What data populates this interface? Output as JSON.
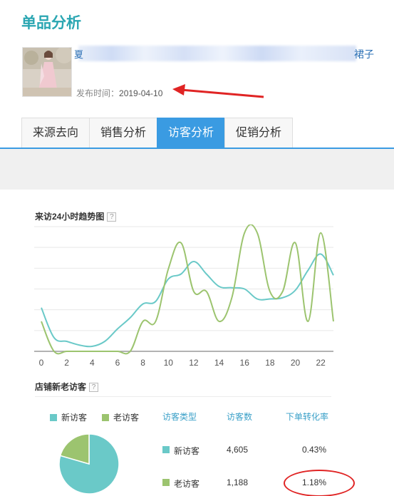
{
  "page_title": "单品分析",
  "product": {
    "name_start": "夏",
    "name_end": "裙子",
    "publish_label": "发布时间：",
    "publish_date": "2019-04-10"
  },
  "tabs": [
    {
      "label": "来源去向",
      "active": false
    },
    {
      "label": "销售分析",
      "active": false
    },
    {
      "label": "访客分析",
      "active": true
    },
    {
      "label": "促销分析",
      "active": false
    }
  ],
  "colors": {
    "accent": "#3a9be2",
    "title": "#2aa6b2",
    "new_visitor": "#6ac9c8",
    "old_visitor": "#9cc46f",
    "highlight_circle": "#e02424",
    "arrow": "#e02424"
  },
  "trend": {
    "title": "来访24小时趋势图",
    "help": "?"
  },
  "chart_data": [
    {
      "type": "line",
      "title": "来访24小时趋势图",
      "x": [
        0,
        1,
        2,
        3,
        4,
        5,
        6,
        7,
        8,
        9,
        10,
        11,
        12,
        13,
        14,
        15,
        16,
        17,
        18,
        19,
        20,
        21,
        22,
        23
      ],
      "xticks": [
        "0",
        "2",
        "4",
        "6",
        "8",
        "10",
        "12",
        "14",
        "16",
        "18",
        "20",
        "22"
      ],
      "xlim": [
        0,
        23
      ],
      "ylim": [
        0,
        100
      ],
      "grid": true,
      "series": [
        {
          "values": [
            35,
            11,
            8,
            5,
            4,
            8,
            18,
            27,
            38,
            40,
            58,
            62,
            72,
            62,
            52,
            51,
            50,
            42,
            42,
            43,
            49,
            65,
            78,
            61
          ]
        },
        {
          "values": [
            24,
            0,
            0,
            0,
            0,
            0,
            0,
            0,
            24,
            24,
            66,
            87,
            48,
            48,
            24,
            43,
            95,
            95,
            48,
            48,
            87,
            24,
            95,
            24
          ]
        }
      ]
    },
    {
      "type": "pie",
      "title": "店铺新老访客",
      "series": [
        {
          "name": "新访客",
          "value": 4605
        },
        {
          "name": "老访客",
          "value": 1188
        }
      ]
    }
  ],
  "visitors": {
    "title": "店铺新老访客",
    "help": "?",
    "legend": [
      {
        "label": "新访客",
        "color": "#6ac9c8"
      },
      {
        "label": "老访客",
        "color": "#9cc46f"
      }
    ],
    "columns": [
      "访客类型",
      "访客数",
      "下单转化率"
    ],
    "rows": [
      {
        "type": "新访客",
        "count": "4,605",
        "rate": "0.43%",
        "color": "#6ac9c8"
      },
      {
        "type": "老访客",
        "count": "1,188",
        "rate": "1.18%",
        "color": "#9cc46f"
      }
    ]
  }
}
